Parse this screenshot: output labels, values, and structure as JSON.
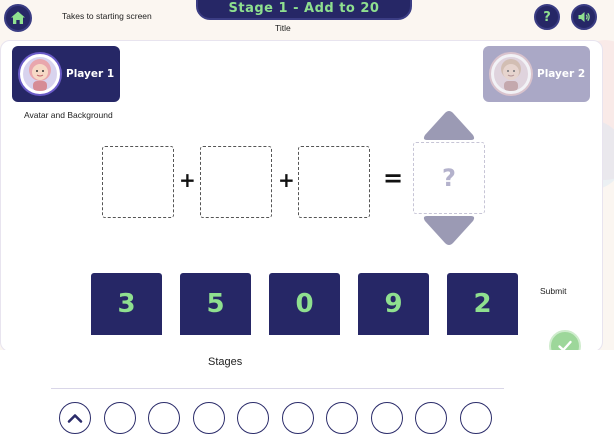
{
  "header": {
    "title": "Stage 1 - Add to 20",
    "help_label": "?"
  },
  "annotations": {
    "home": "Takes to starting screen",
    "title": "Title",
    "avatar": "Avatar and Background",
    "submit": "Submit"
  },
  "players": [
    {
      "name": "Player 1",
      "active": true
    },
    {
      "name": "Player 2",
      "active": false
    }
  ],
  "equation": {
    "operators": [
      "+",
      "+"
    ],
    "equals": "=",
    "answer_placeholder": "?"
  },
  "number_cards": [
    "3",
    "5",
    "0",
    "9",
    "2"
  ],
  "stages": {
    "label": "Stages",
    "count": 10,
    "current": 1
  },
  "colors": {
    "navy": "#262766",
    "number_green": "#8fe08f",
    "player2_inactive": "#aaa8c6",
    "submit_green": "#9dd79a"
  },
  "icons": {
    "home": "home-icon",
    "help": "question-icon",
    "sound": "speaker-icon",
    "arrow_up": "triangle-up-icon",
    "arrow_down": "triangle-down-icon",
    "submit": "checkmark-icon",
    "stage_current": "chevron-up-icon"
  }
}
